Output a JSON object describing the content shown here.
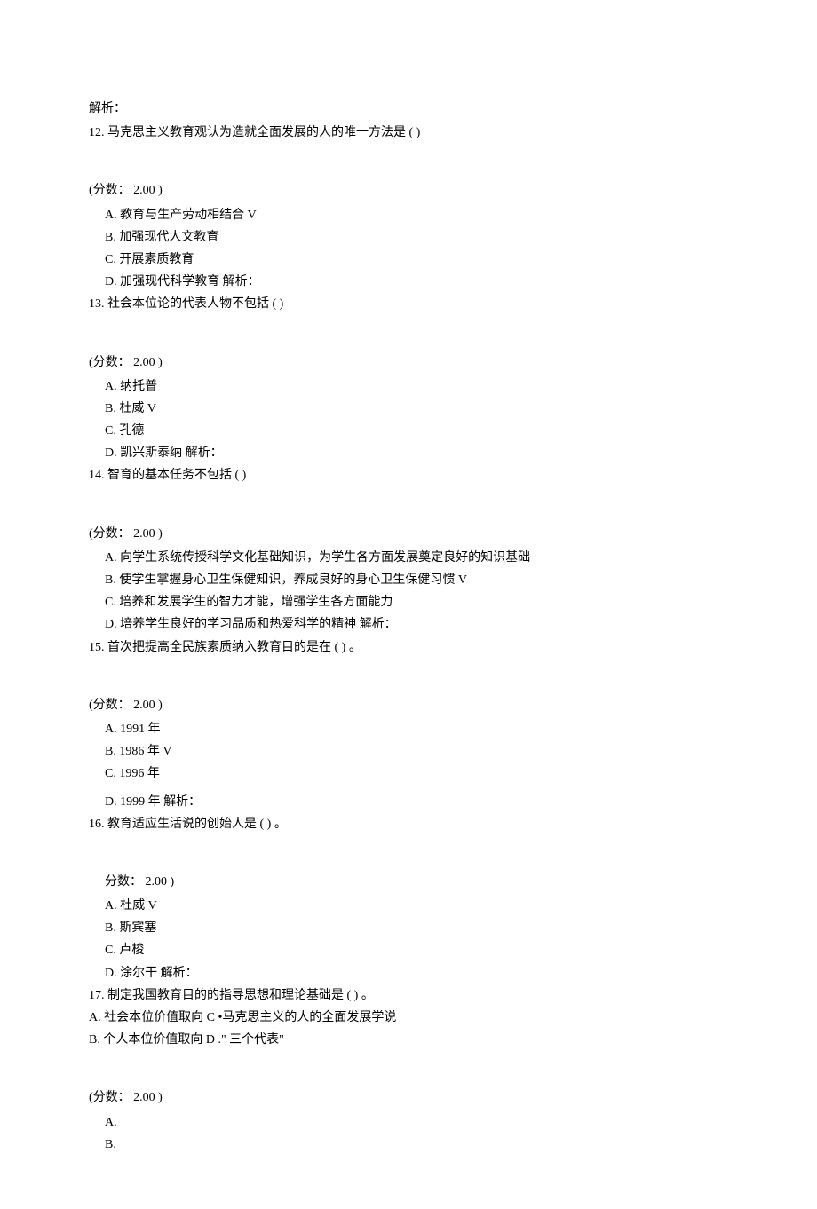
{
  "intro": {
    "jiexi": "解析：",
    "lead": "12.  马克思主义教育观认为造就全面发展的人的唯一方法是 ( )"
  },
  "q12": {
    "score": "(分数：  2.00 )",
    "a": "A.  教育与生产劳动相结合  V",
    "b": "B.  加强现代人文教育",
    "c": "C.  开展素质教育",
    "d": "D.  加强现代科学教育  解析：",
    "next": "13.  社会本位论的代表人物不包括 ( )"
  },
  "q13": {
    "score": "(分数：  2.00 )",
    "a": "A.  纳托普",
    "b": "B.  杜威  V",
    "c": "C.  孔德",
    "d": "D.  凯兴斯泰纳  解析：",
    "next": "14.  智育的基本任务不包括 ( )"
  },
  "q14": {
    "score": "(分数：  2.00 )",
    "a": "A.  向学生系统传授科学文化基础知识，为学生各方面发展奠定良好的知识基础",
    "b": "B.  使学生掌握身心卫生保健知识，养成良好的身心卫生保健习惯           V",
    "c": "C.  培养和发展学生的智力才能，增强学生各方面能力",
    "d": "D.  培养学生良好的学习品质和热爱科学的精神  解析：",
    "next": "15.  首次把提高全民族素质纳入教育目的是在 ( ) 。"
  },
  "q15": {
    "score": "(分数：  2.00 )",
    "a": "A.  1991 年",
    "b": "B.  1986 年  V",
    "c": "C.  1996 年",
    "d": "D.  1999 年  解析：",
    "next": "16.  教育适应生活说的创始人是 ( ) 。"
  },
  "q16": {
    "score": "分数：  2.00 )",
    "a": "A.  杜威  V",
    "b": "B.  斯宾塞",
    "c": "C.  卢梭",
    "d": "D.  涂尔干  解析：",
    "next": "17.  制定我国教育目的的指导思想和理论基础是 ( ) 。",
    "extra1": "A.   社会本位价值取向 C •马克思主义的人的全面发展学说",
    "extra2": "B.   个人本位价值取向 D .\" 三个代表\""
  },
  "q17": {
    "score": "(分数：  2.00 )",
    "a": "A.",
    "b": "B."
  }
}
